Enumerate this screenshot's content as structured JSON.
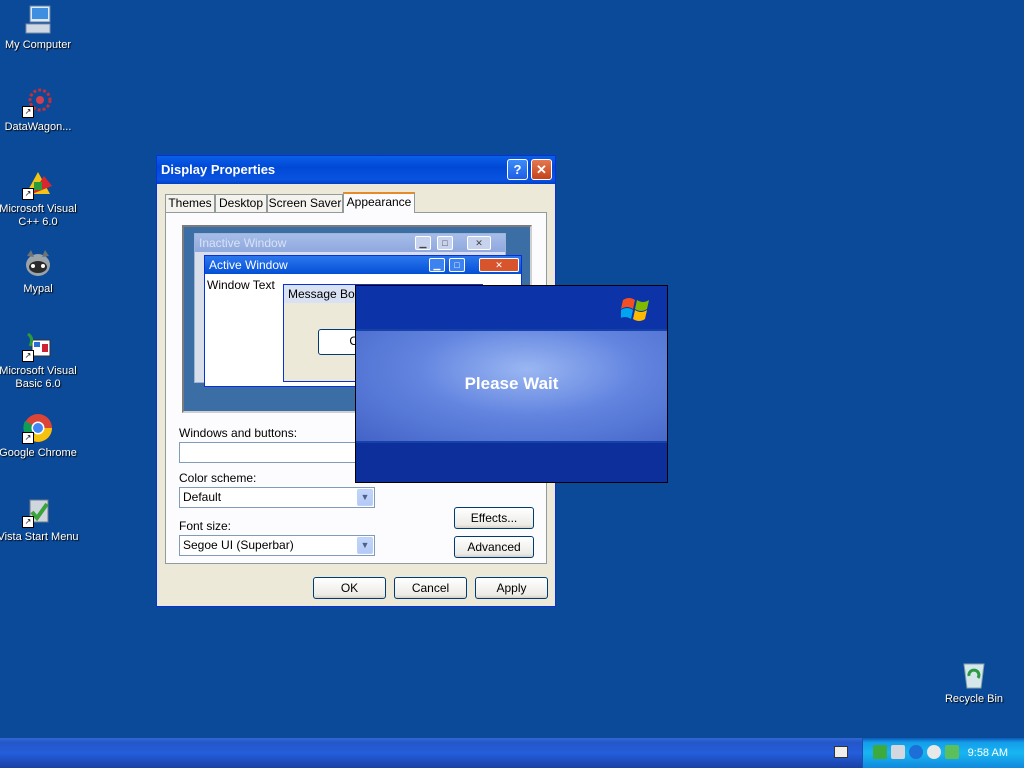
{
  "desktop_icons": [
    {
      "label": "My Computer",
      "icon": "computer-icon"
    },
    {
      "label": "DataWagon...",
      "icon": "datawagon-icon"
    },
    {
      "label": "Microsoft Visual C++ 6.0",
      "icon": "visual-cpp-icon"
    },
    {
      "label": "Mypal",
      "icon": "mypal-icon"
    },
    {
      "label": "Microsoft Visual Basic 6.0",
      "icon": "visual-basic-icon"
    },
    {
      "label": "Google Chrome",
      "icon": "chrome-icon"
    },
    {
      "label": "Vista Start Menu",
      "icon": "vista-start-icon"
    },
    {
      "label": "Recycle Bin",
      "icon": "recycle-bin-icon"
    }
  ],
  "window": {
    "title": "Display Properties",
    "help_glyph": "?",
    "close_glyph": "✕",
    "tabs": [
      "Themes",
      "Desktop",
      "Screen Saver",
      "Appearance"
    ],
    "active_tab": "Appearance",
    "preview": {
      "inactive_title": "Inactive Window",
      "active_title": "Active Window",
      "window_text": "Window Text",
      "message_box_title": "Message Box",
      "ok_partial": "O"
    },
    "windows_and_buttons_label": "Windows and buttons:",
    "windows_and_buttons_value": "",
    "color_scheme_label": "Color scheme:",
    "color_scheme_value": "Default",
    "font_size_label": "Font size:",
    "font_size_value": "Segoe UI (Superbar)",
    "effects_button": "Effects...",
    "advanced_button": "Advanced",
    "ok_button": "OK",
    "cancel_button": "Cancel",
    "apply_button": "Apply"
  },
  "splash": {
    "message": "Please Wait"
  },
  "taskbar": {
    "time": "9:58 AM"
  },
  "colors": {
    "desktop": "#0b4a98",
    "titlebar": "#0054e3",
    "splash_mid": "#6385e0"
  }
}
